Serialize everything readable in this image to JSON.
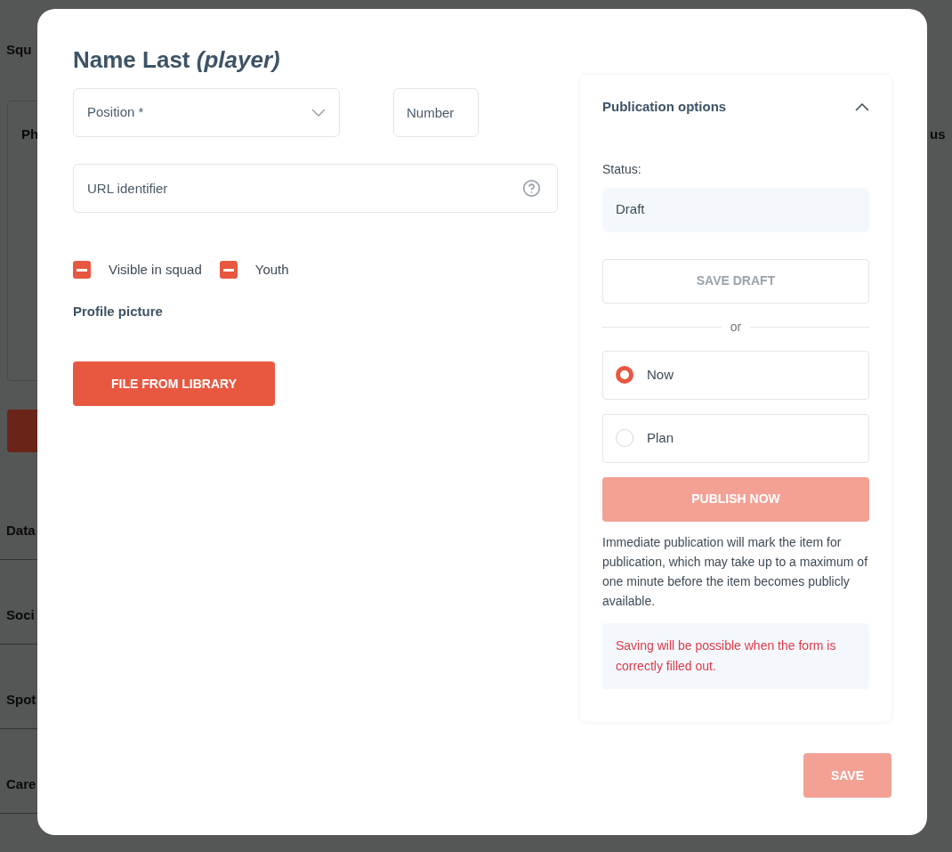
{
  "background": {
    "left_labels": [
      "Squ",
      "Ph",
      "Data",
      "Soci",
      "Spot",
      "Care"
    ],
    "right_label": "us"
  },
  "dialog": {
    "title": "Name Last",
    "title_suffix": "(player)",
    "position_select": {
      "placeholder": "Position *"
    },
    "number_field": {
      "placeholder": "Number"
    },
    "url_field": {
      "placeholder": "URL identifier"
    },
    "checkboxes": [
      {
        "label": "Visible in squad",
        "indeterminate": true
      },
      {
        "label": "Youth",
        "indeterminate": true
      }
    ],
    "profile_picture_label": "Profile picture",
    "library_button": "FILE FROM LIBRARY",
    "publication": {
      "title": "Publication options",
      "expanded": true,
      "status_label": "Status:",
      "status_value": "Draft",
      "save_draft": {
        "label": "SAVE DRAFT",
        "disabled": true
      },
      "separator": "or",
      "options": [
        {
          "label": "Now",
          "selected": true
        },
        {
          "label": "Plan",
          "selected": false
        }
      ],
      "publish": {
        "label": "PUBLISH NOW",
        "disabled": true
      },
      "info": "Immediate publication will mark the item for publication, which may take up to a maximum of one minute before the item becomes publicly available.",
      "error": "Saving will be possible when the form is correctly filled out."
    },
    "save": {
      "label": "SAVE",
      "disabled": true
    }
  }
}
